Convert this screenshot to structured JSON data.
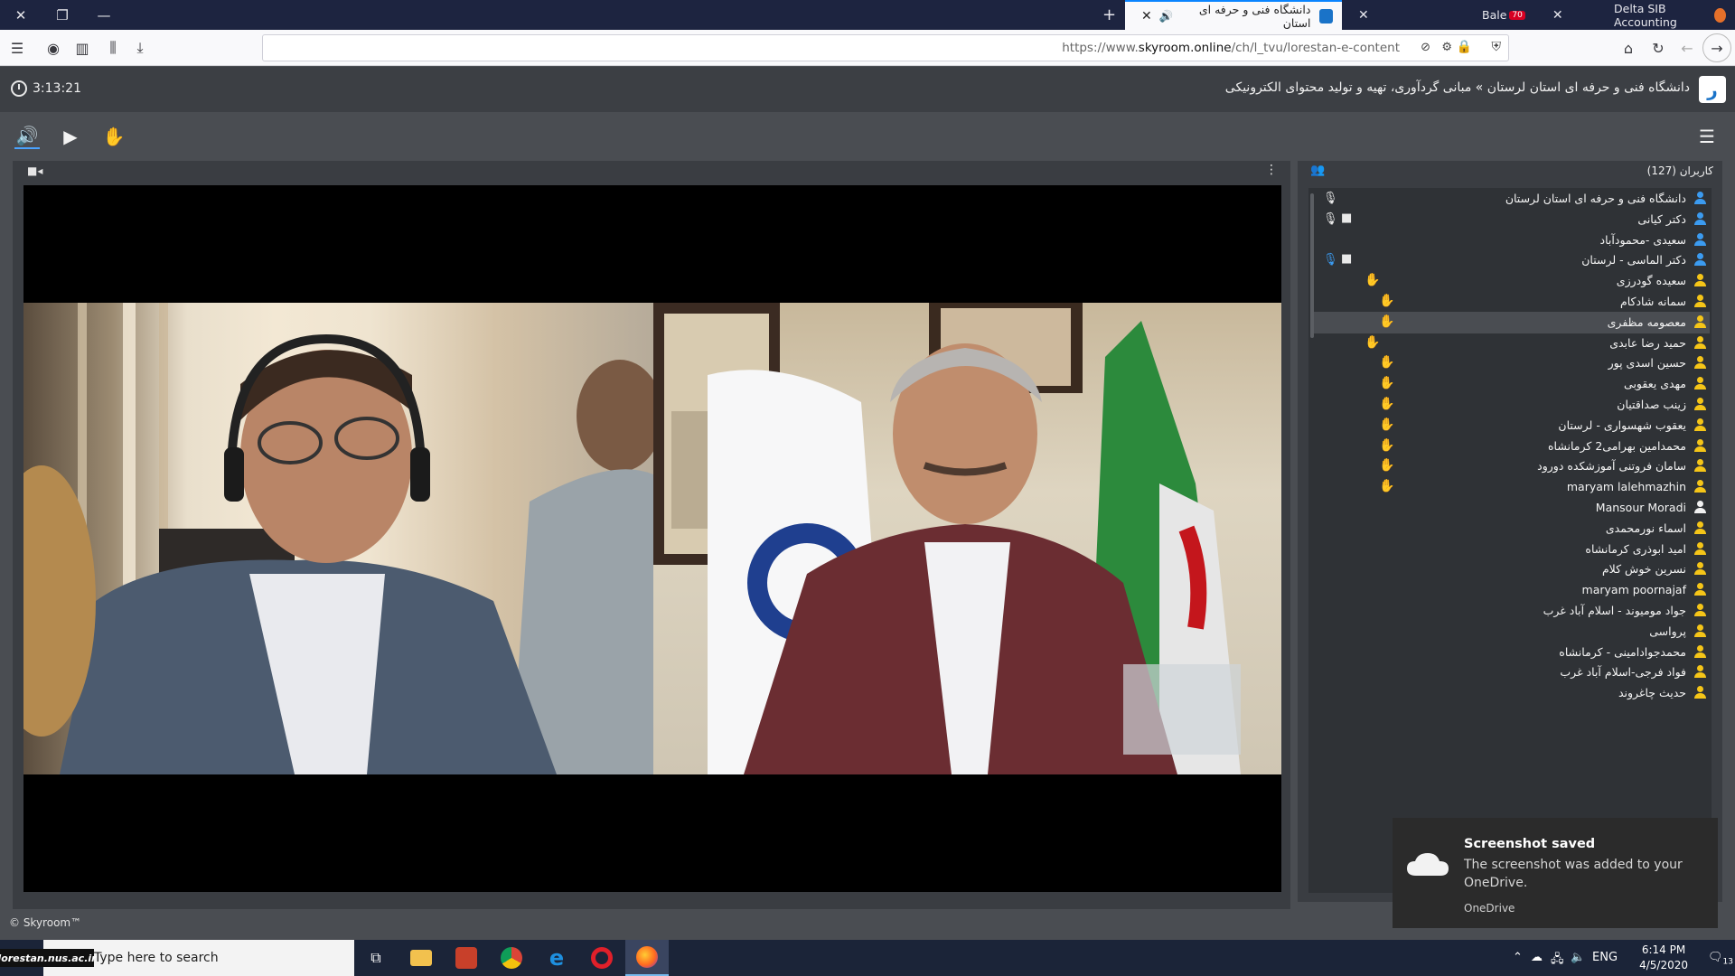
{
  "browser": {
    "tabs": [
      {
        "title": "Delta SIB Accounting",
        "active": false
      },
      {
        "title": "Bale",
        "badge": "70",
        "active": false
      },
      {
        "title": "دانشگاه فنی و حرفه ای استان",
        "active": true
      }
    ],
    "url_prefix": "https://www.",
    "url_domain": "skyroom.online",
    "url_path": "/ch/l_tvu/lorestan-e-content"
  },
  "room": {
    "breadcrumb": "دانشگاه فنی و حرفه ای استان لرستان » مبانی گردآوری، تهیه و تولید محتوای الکترونیکی",
    "timer": "3:13:21",
    "logo_glyph": "ر"
  },
  "users": {
    "title": "کاربران (127)",
    "list": [
      {
        "name": "دانشگاه فنی و حرفه ای استان لرستان",
        "role": "presenter",
        "mic": "on",
        "cam": false,
        "hand": false
      },
      {
        "name": "دکتر کیانی",
        "role": "presenter",
        "mic": "on",
        "cam": true,
        "hand": false
      },
      {
        "name": "سعیدی -محمودآباد",
        "role": "presenter",
        "mic": "",
        "cam": false,
        "hand": false
      },
      {
        "name": "دکتر الماسی - لرستان",
        "role": "presenter",
        "mic": "active",
        "cam": true,
        "hand": false
      },
      {
        "name": "سعیده گودرزی",
        "role": "listener",
        "mic": "",
        "cam": false,
        "hand": true,
        "hand_pos": "a"
      },
      {
        "name": "سمانه شادکام",
        "role": "listener",
        "mic": "",
        "cam": false,
        "hand": true,
        "hand_pos": "b"
      },
      {
        "name": "معصومه مظفری",
        "role": "listener",
        "mic": "",
        "cam": false,
        "hand": true,
        "hand_pos": "b",
        "selected": true
      },
      {
        "name": "حمید رضا عابدی",
        "role": "listener",
        "mic": "",
        "cam": false,
        "hand": true,
        "hand_pos": "a"
      },
      {
        "name": "حسین اسدی پور",
        "role": "listener",
        "mic": "",
        "cam": false,
        "hand": true,
        "hand_pos": "b"
      },
      {
        "name": "مهدی یعقوبی",
        "role": "listener",
        "mic": "",
        "cam": false,
        "hand": true,
        "hand_pos": "b"
      },
      {
        "name": "زینب صداقتیان",
        "role": "listener",
        "mic": "",
        "cam": false,
        "hand": true,
        "hand_pos": "b"
      },
      {
        "name": "یعقوب شهسواری - لرستان",
        "role": "listener",
        "mic": "",
        "cam": false,
        "hand": true,
        "hand_pos": "b"
      },
      {
        "name": "محمدامین بهرامی2 کرمانشاه",
        "role": "listener",
        "mic": "",
        "cam": false,
        "hand": true,
        "hand_pos": "b"
      },
      {
        "name": "سامان فروتنی آموزشکده دورود",
        "role": "listener",
        "mic": "",
        "cam": false,
        "hand": true,
        "hand_pos": "b"
      },
      {
        "name": "maryam lalehmazhin",
        "role": "listener",
        "mic": "",
        "cam": false,
        "hand": true,
        "hand_pos": "b"
      },
      {
        "name": "Mansour Moradi",
        "role": "guest",
        "mic": "",
        "cam": false,
        "hand": false
      },
      {
        "name": "اسماء نورمحمدی",
        "role": "listener",
        "mic": "",
        "cam": false,
        "hand": false
      },
      {
        "name": "امید ابوذری کرمانشاه",
        "role": "listener",
        "mic": "",
        "cam": false,
        "hand": false
      },
      {
        "name": "نسرین خوش کلام",
        "role": "listener",
        "mic": "",
        "cam": false,
        "hand": false
      },
      {
        "name": "maryam poornajaf",
        "role": "listener",
        "mic": "",
        "cam": false,
        "hand": false
      },
      {
        "name": "جواد مومیوند - اسلام آباد غرب",
        "role": "listener",
        "mic": "",
        "cam": false,
        "hand": false
      },
      {
        "name": "پرواسی",
        "role": "listener",
        "mic": "",
        "cam": false,
        "hand": false
      },
      {
        "name": "محمدجوادامینی - کرمانشاه",
        "role": "listener",
        "mic": "",
        "cam": false,
        "hand": false
      },
      {
        "name": "فواد فرجی-اسلام آباد غرب",
        "role": "listener",
        "mic": "",
        "cam": false,
        "hand": false
      },
      {
        "name": "حدیث چاغروند",
        "role": "listener",
        "mic": "",
        "cam": false,
        "hand": false
      }
    ]
  },
  "colors": {
    "presenter": "#3b9bf0",
    "listener": "#f5c518",
    "guest": "#f1f1f1",
    "mic_active": "#3b9bf0"
  },
  "footer": "© Skyroom™",
  "toast": {
    "title": "Screenshot saved",
    "body": "The screenshot was added to your OneDrive.",
    "source": "OneDrive"
  },
  "taskbar": {
    "search_placeholder": "Type here to search",
    "watermark": "lorestan.nus.ac.ir",
    "language": "ENG",
    "time": "6:14 PM",
    "date": "4/5/2020",
    "notification_count": "13"
  }
}
